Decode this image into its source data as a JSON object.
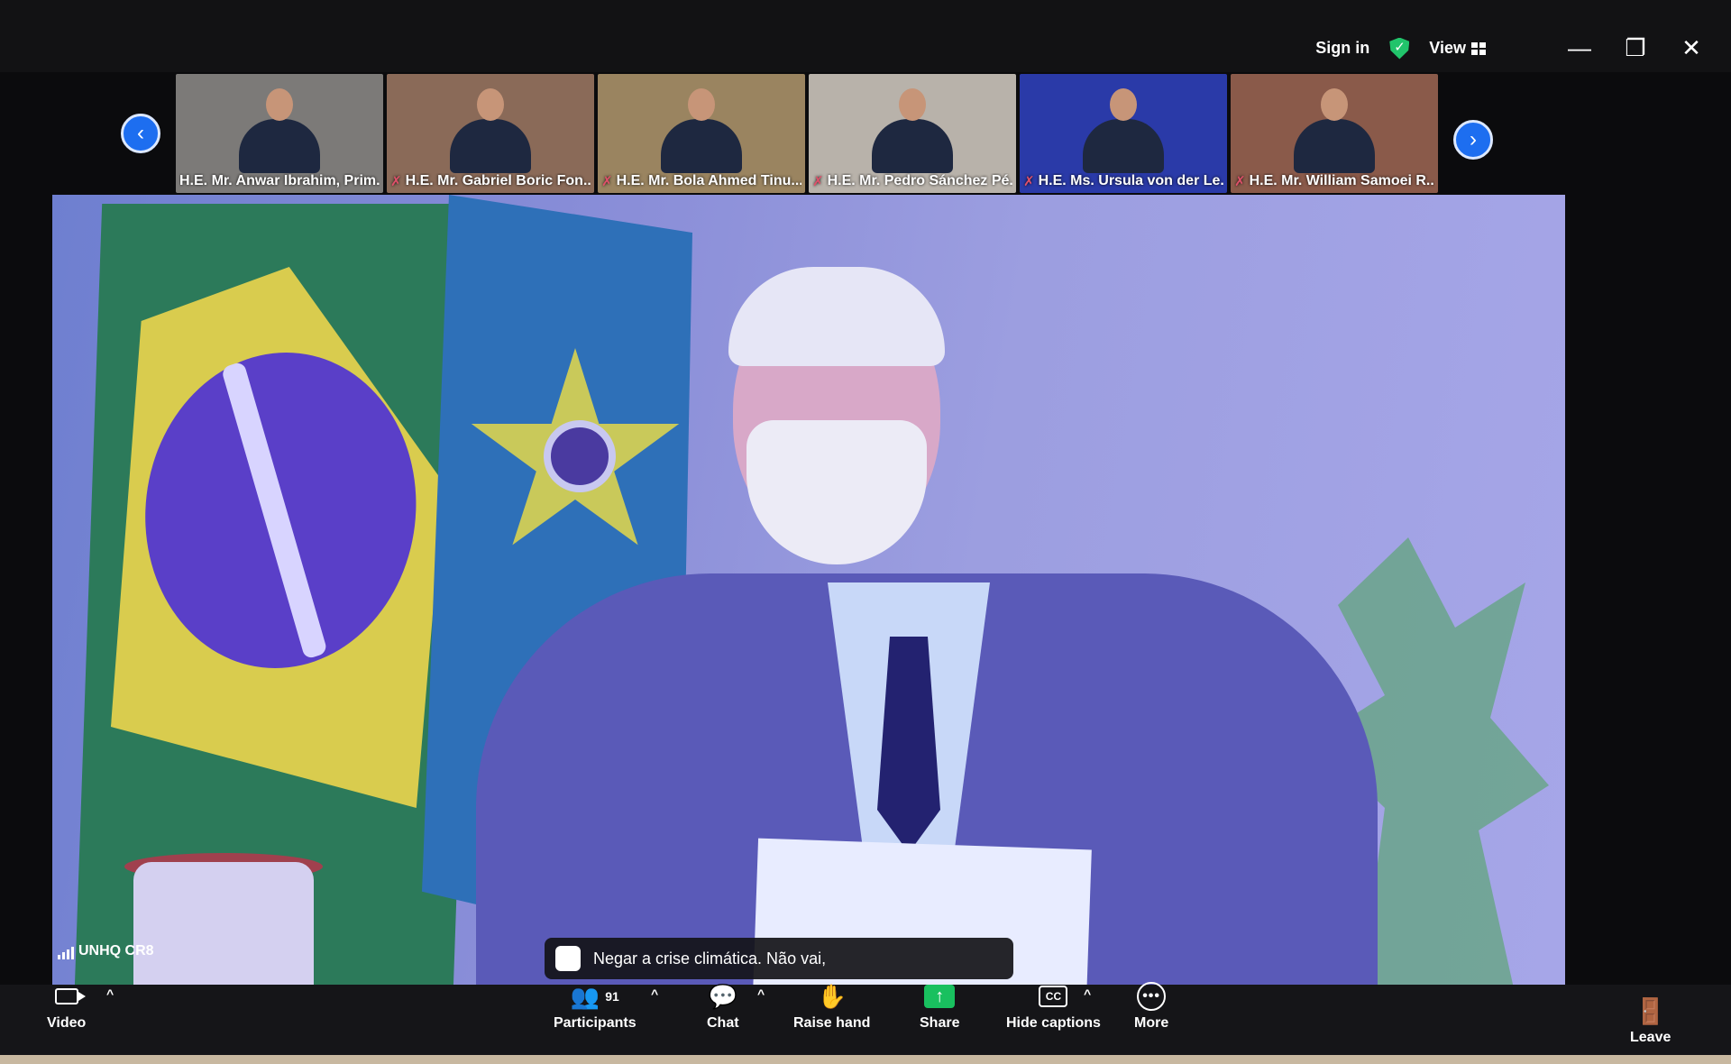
{
  "window": {
    "sign_in": "Sign in",
    "view": "View",
    "minimize": "—",
    "restore": "❐",
    "close": "✕"
  },
  "thumbnails": [
    {
      "name": "H.E. Mr. Anwar Ibrahim, Prim...",
      "bg": "#7c7a78",
      "muted": false
    },
    {
      "name": "H.E. Mr. Gabriel Boric Fon...",
      "bg": "#8a6a58",
      "muted": true
    },
    {
      "name": "H.E. Mr. Bola Ahmed Tinu...",
      "bg": "#9a8460",
      "muted": true
    },
    {
      "name": "H.E. Mr. Pedro Sánchez Pé...",
      "bg": "#b8b2aa",
      "muted": true
    },
    {
      "name": "H.E. Ms. Ursula von der Le...",
      "bg": "#2a3aa8",
      "muted": true
    },
    {
      "name": "H.E. Mr. William Samoei R...",
      "bg": "#8a5a4a",
      "muted": true
    }
  ],
  "main": {
    "room_label": "UNHQ CR8",
    "caption": "Negar a crise climática. Não vai,"
  },
  "toolbar": {
    "video": "Video",
    "participants": "Participants",
    "participants_count": "91",
    "chat": "Chat",
    "raise_hand": "Raise hand",
    "share": "Share",
    "hide_captions": "Hide captions",
    "more": "More",
    "leave": "Leave"
  },
  "colors": {
    "accent": "#1d6ef0",
    "share": "#19c05f",
    "shield": "#21c46b",
    "leave": "#e0506a"
  }
}
